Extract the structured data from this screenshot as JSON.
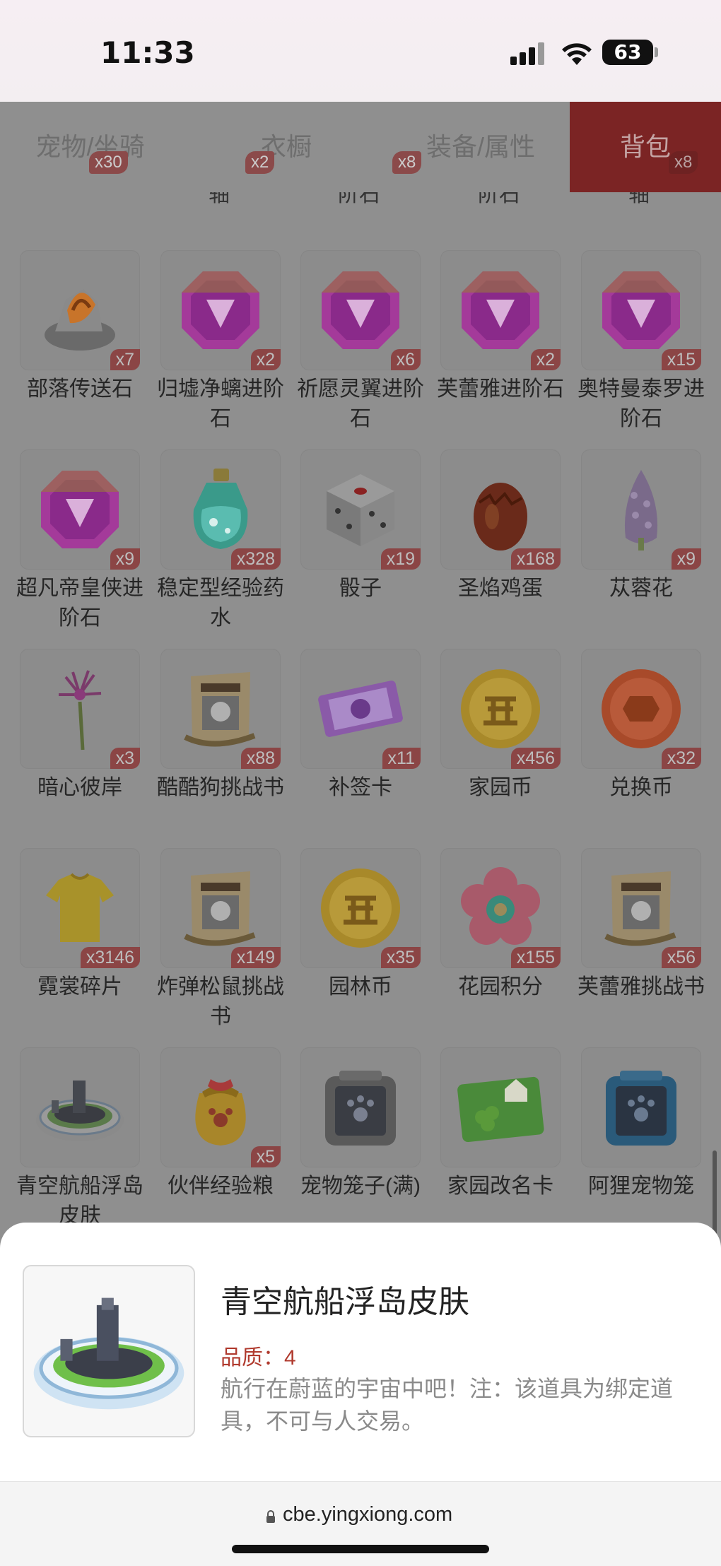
{
  "status": {
    "time": "11:33",
    "battery": "63"
  },
  "tabs": [
    {
      "label": "宠物/坐骑",
      "badge": "x30"
    },
    {
      "label": "衣橱",
      "badge": "x2"
    },
    {
      "label": "装备/属性",
      "badge": "x8"
    },
    {
      "label": "背包",
      "badge": "x8"
    }
  ],
  "partial_labels": [
    "轴",
    "阶石",
    "阶石",
    "轴"
  ],
  "items": [
    {
      "name": "部落传送石",
      "qty": "x7",
      "icon": "stone-icon"
    },
    {
      "name": "归墟净螭进阶石",
      "qty": "x2",
      "icon": "gem-icon"
    },
    {
      "name": "祈愿灵翼进阶石",
      "qty": "x6",
      "icon": "gem-icon"
    },
    {
      "name": "芙蕾雅进阶石",
      "qty": "x2",
      "icon": "gem-icon"
    },
    {
      "name": "奥特曼泰罗进阶石",
      "qty": "x15",
      "icon": "gem-icon"
    },
    {
      "name": "超凡帝皇侠进阶石",
      "qty": "x9",
      "icon": "gem-icon"
    },
    {
      "name": "稳定型经验药水",
      "qty": "x328",
      "icon": "potion-icon"
    },
    {
      "name": "骰子",
      "qty": "x19",
      "icon": "dice-icon"
    },
    {
      "name": "圣焰鸡蛋",
      "qty": "x168",
      "icon": "egg-icon"
    },
    {
      "name": "苁蓉花",
      "qty": "x9",
      "icon": "flower-cone-icon"
    },
    {
      "name": "暗心彼岸",
      "qty": "x3",
      "icon": "flower-icon"
    },
    {
      "name": "酷酷狗挑战书",
      "qty": "x88",
      "icon": "wanted-scroll-icon"
    },
    {
      "name": "补签卡",
      "qty": "x11",
      "icon": "ticket-icon"
    },
    {
      "name": "家园币",
      "qty": "x456",
      "icon": "coin-icon"
    },
    {
      "name": "兑换币",
      "qty": "x32",
      "icon": "coin-red-icon"
    },
    {
      "name": "霓裳碎片",
      "qty": "x3146",
      "icon": "shirt-icon"
    },
    {
      "name": "炸弹松鼠挑战书",
      "qty": "x149",
      "icon": "wanted-scroll-icon"
    },
    {
      "name": "园林币",
      "qty": "x35",
      "icon": "coin-icon"
    },
    {
      "name": "花园积分",
      "qty": "x155",
      "icon": "flower-badge-icon"
    },
    {
      "name": "芙蕾雅挑战书",
      "qty": "x56",
      "icon": "wanted-scroll-icon"
    },
    {
      "name": "青空航船浮岛皮肤",
      "qty": "",
      "icon": "island-icon"
    },
    {
      "name": "伙伴经验粮",
      "qty": "x5",
      "icon": "bag-icon"
    },
    {
      "name": "宠物笼子(满)",
      "qty": "",
      "icon": "cage-icon"
    },
    {
      "name": "家园改名卡",
      "qty": "",
      "icon": "card-icon"
    },
    {
      "name": "阿狸宠物笼",
      "qty": "",
      "icon": "cage-blue-icon"
    }
  ],
  "detail": {
    "title": "青空航船浮岛皮肤",
    "quality": "品质：4",
    "description": "航行在蔚蓝的宇宙中吧！注：该道具为绑定道具，不可与人交易。"
  },
  "url": "cbe.yingxiong.com",
  "colors": {
    "accent": "#b03a2e",
    "active_tab": "#7b2424"
  }
}
